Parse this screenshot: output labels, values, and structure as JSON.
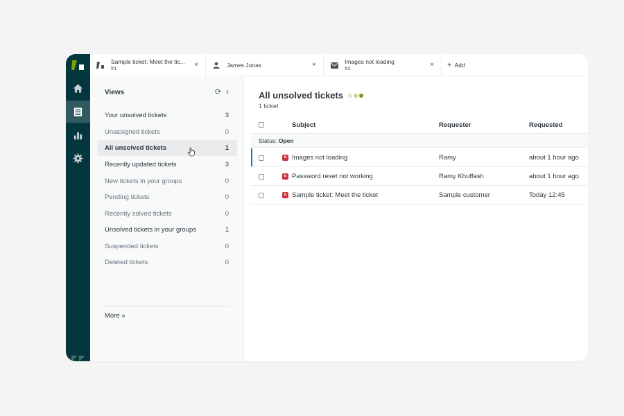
{
  "colors": {
    "rail": "#03363d",
    "rail_active": "#2f5a5f",
    "logo": "#78a300",
    "status_open": "#cc3340",
    "selection": "#1f73b7"
  },
  "tabs": [
    {
      "icon": "ticket-icon",
      "title": "Sample ticket: Meet the tic...",
      "subtitle": "#1",
      "close": "×"
    },
    {
      "icon": "user-icon",
      "title": "James Jonas",
      "subtitle": "",
      "close": "×"
    },
    {
      "icon": "mail-icon",
      "title": "Images not loading",
      "subtitle": "#3",
      "close": "×"
    }
  ],
  "add_tab": {
    "plus": "+",
    "label": "Add"
  },
  "views_panel": {
    "title": "Views",
    "refresh_icon": "⟳",
    "collapse_icon": "‹",
    "items": [
      {
        "label": "Your unsolved tickets",
        "count": "3",
        "style": "strong"
      },
      {
        "label": "Unassigned tickets",
        "count": "0",
        "style": "dim"
      },
      {
        "label": "All unsolved tickets",
        "count": "1",
        "style": "active"
      },
      {
        "label": "Recently updated tickets",
        "count": "3",
        "style": "strong"
      },
      {
        "label": "New tickets in your groups",
        "count": "0",
        "style": "dim"
      },
      {
        "label": "Pending tickets",
        "count": "0",
        "style": "dim"
      },
      {
        "label": "Recently solved tickets",
        "count": "0",
        "style": "dim"
      },
      {
        "label": "Unsolved tickets in your groups",
        "count": "1",
        "style": "strong"
      },
      {
        "label": "Suspended tickets",
        "count": "0",
        "style": "dim"
      },
      {
        "label": "Deleted tickets",
        "count": "0",
        "style": "dim"
      }
    ],
    "more": "More »"
  },
  "main": {
    "title": "All unsolved tickets",
    "count": "1 ticket",
    "columns": {
      "subject": "Subject",
      "requester": "Requester",
      "requested": "Requested"
    },
    "group": {
      "prefix": "Status:",
      "value": "Open"
    },
    "rows": [
      {
        "status": "o",
        "subject": "Images not loading",
        "requester": "Ramy",
        "requested": "about 1 hour ago",
        "selected": true
      },
      {
        "status": "o",
        "subject": "Password reset not working",
        "requester": "Ramy Khuffash",
        "requested": "about 1 hour ago",
        "selected": false
      },
      {
        "status": "o",
        "subject": "Sample ticket: Meet the ticket",
        "requester": "Sample customer",
        "requested": "Today 12:45",
        "selected": false
      }
    ]
  }
}
